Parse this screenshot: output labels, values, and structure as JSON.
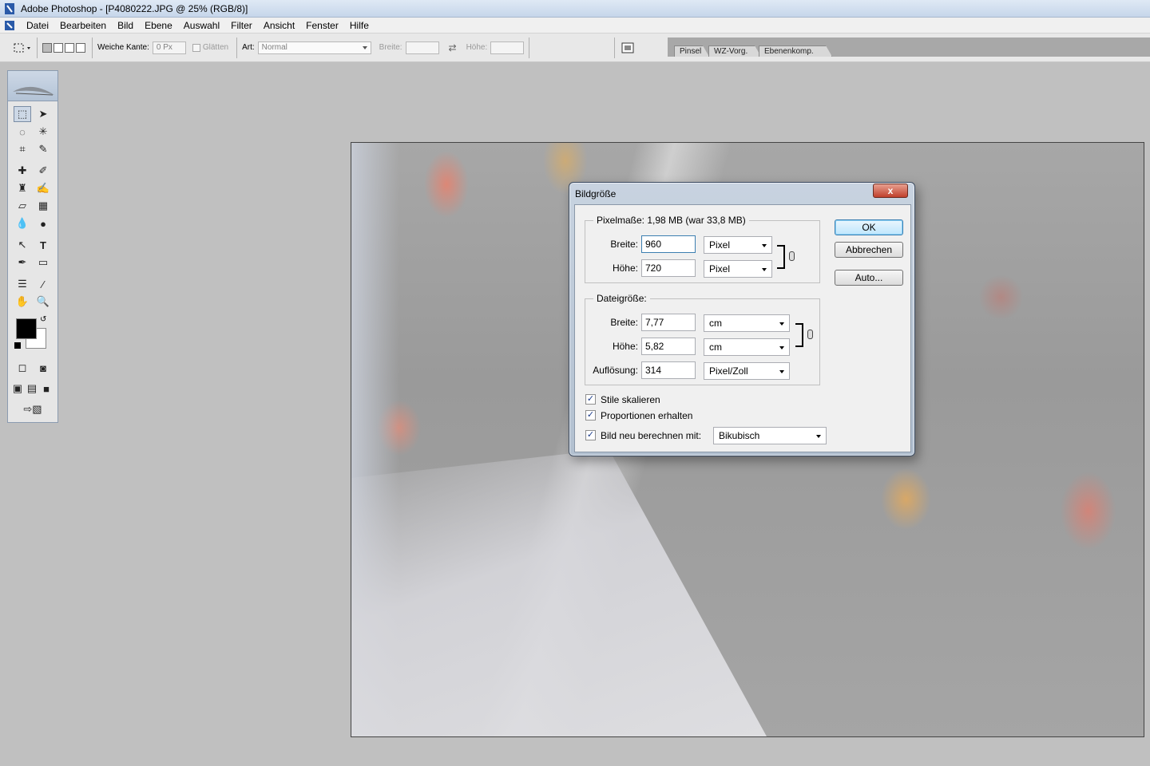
{
  "window": {
    "title": "Adobe Photoshop - [P4080222.JPG @ 25% (RGB/8)]"
  },
  "menu": [
    "Datei",
    "Bearbeiten",
    "Bild",
    "Ebene",
    "Auswahl",
    "Filter",
    "Ansicht",
    "Fenster",
    "Hilfe"
  ],
  "options": {
    "feather_label": "Weiche Kante:",
    "feather_value": "0 Px",
    "antialias_label": "Glätten",
    "style_label": "Art:",
    "style_value": "Normal",
    "width_label": "Breite:",
    "height_label": "Höhe:"
  },
  "palette_well": {
    "tabs": [
      "Pinsel",
      "WZ-Vorg.",
      "Ebenenkomp."
    ]
  },
  "toolbox": {
    "foreground_color": "#000000",
    "background_color": "#ffffff"
  },
  "dialog": {
    "title": "Bildgröße",
    "close_label": "x",
    "pixel_group": {
      "legend": "Pixelmaße: 1,98 MB (war 33,8 MB)",
      "width_label": "Breite:",
      "width_value": "960",
      "width_unit": "Pixel",
      "height_label": "Höhe:",
      "height_value": "720",
      "height_unit": "Pixel"
    },
    "doc_group": {
      "legend": "Dateigröße:",
      "width_label": "Breite:",
      "width_value": "7,77",
      "width_unit": "cm",
      "height_label": "Höhe:",
      "height_value": "5,82",
      "height_unit": "cm",
      "resolution_label": "Auflösung:",
      "resolution_value": "314",
      "resolution_unit": "Pixel/Zoll"
    },
    "checkboxes": {
      "scale_styles": "Stile skalieren",
      "constrain": "Proportionen erhalten",
      "resample": "Bild neu berechnen mit:"
    },
    "resample_method": "Bikubisch",
    "buttons": {
      "ok": "OK",
      "cancel": "Abbrechen",
      "auto": "Auto..."
    }
  }
}
